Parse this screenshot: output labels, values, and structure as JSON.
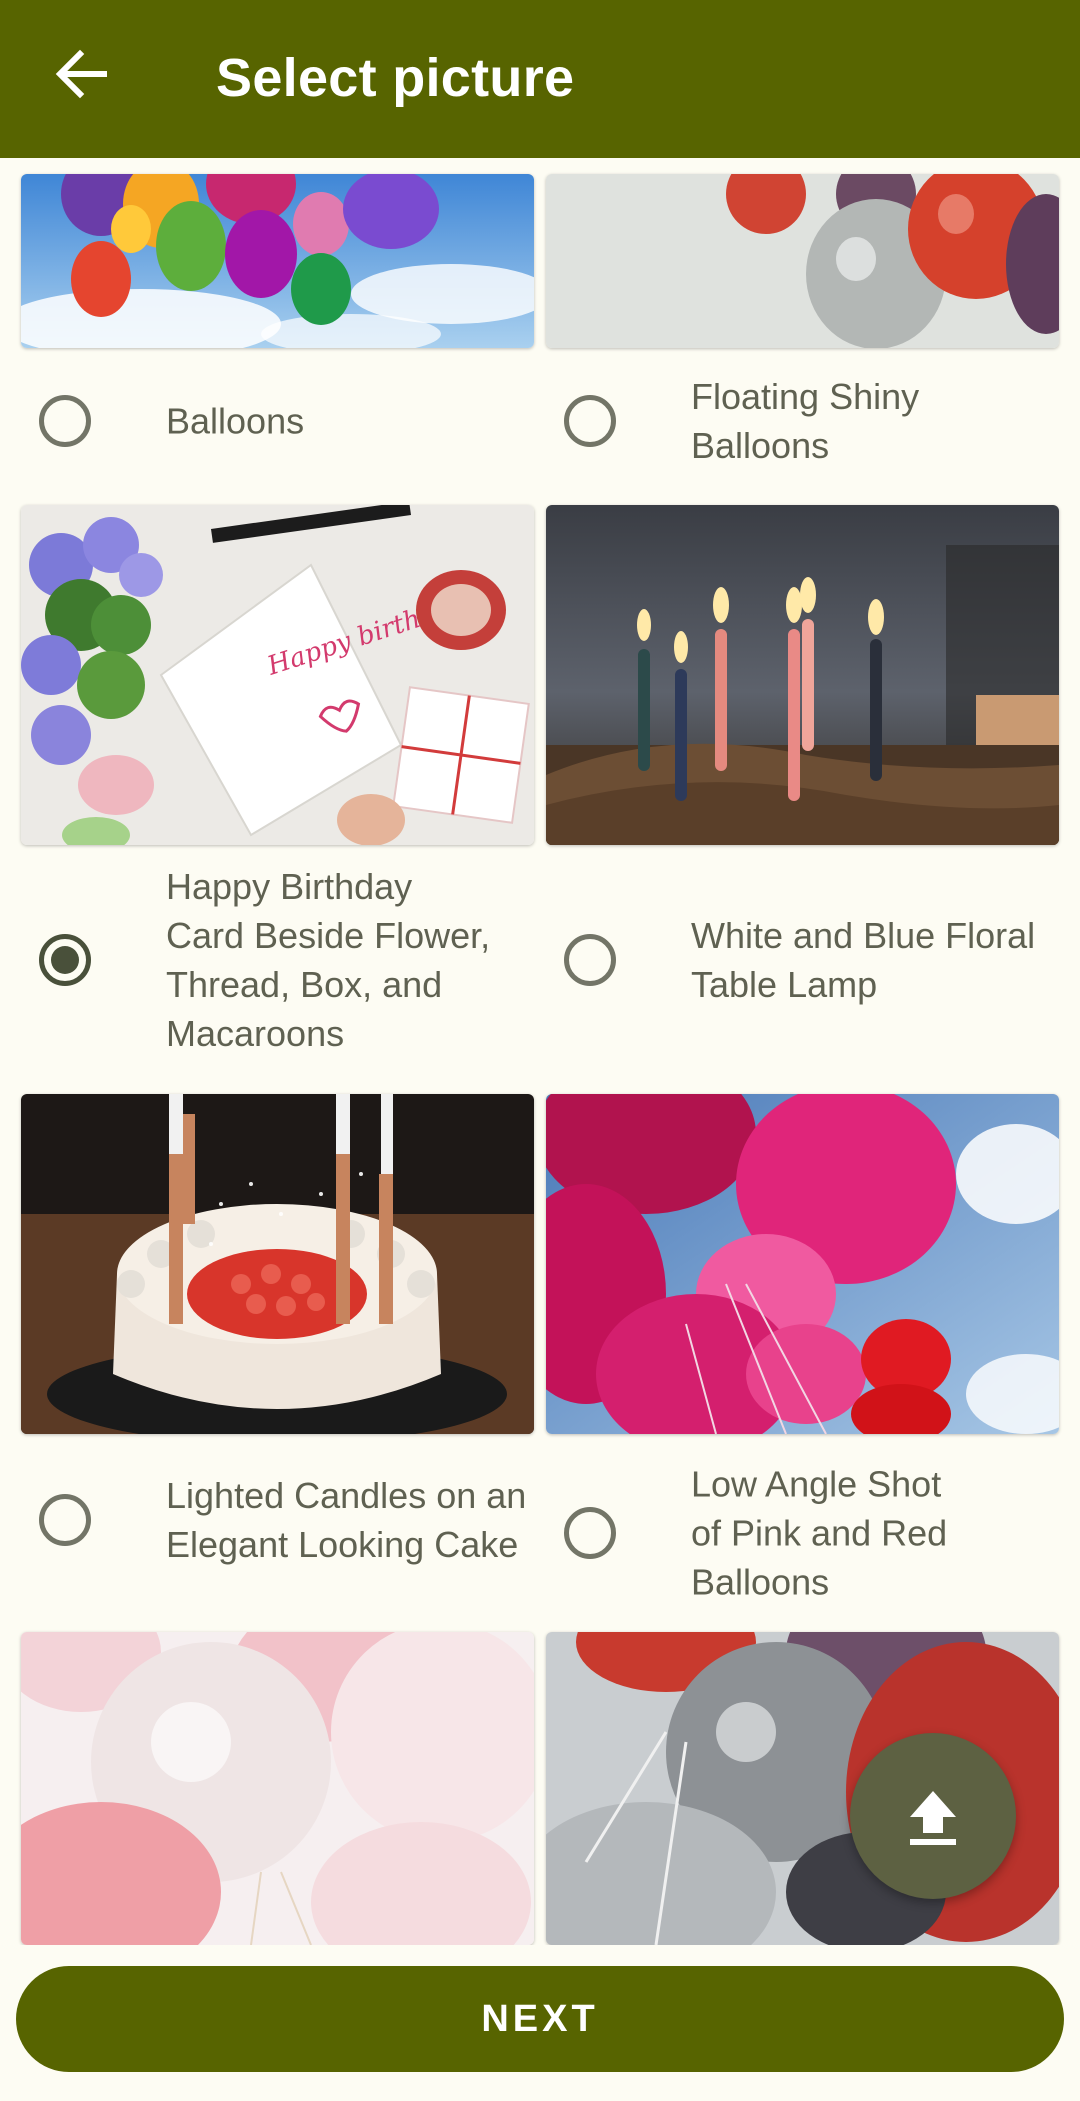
{
  "appbar": {
    "title": "Select picture",
    "back_icon": "arrow-left-icon"
  },
  "pictures": [
    {
      "label": "Balloons",
      "selected": false
    },
    {
      "label": "Floating Shiny\nBalloons",
      "selected": false
    },
    {
      "label": "Happy Birthday\nCard Beside Flower,\nThread, Box, and\nMacaroons",
      "selected": true
    },
    {
      "label": "White and Blue Floral\nTable Lamp",
      "selected": false
    },
    {
      "label": "Lighted Candles on an\nElegant Looking Cake",
      "selected": false
    },
    {
      "label": "Low Angle Shot\nof Pink and Red\nBalloons",
      "selected": false
    }
  ],
  "card_text": "Happy birthday!",
  "fab": {
    "icon": "upload-icon"
  },
  "next_button": {
    "label": "NEXT"
  },
  "colors": {
    "primary": "#576400",
    "background": "#fdfcf3",
    "fab": "#5d6142"
  }
}
